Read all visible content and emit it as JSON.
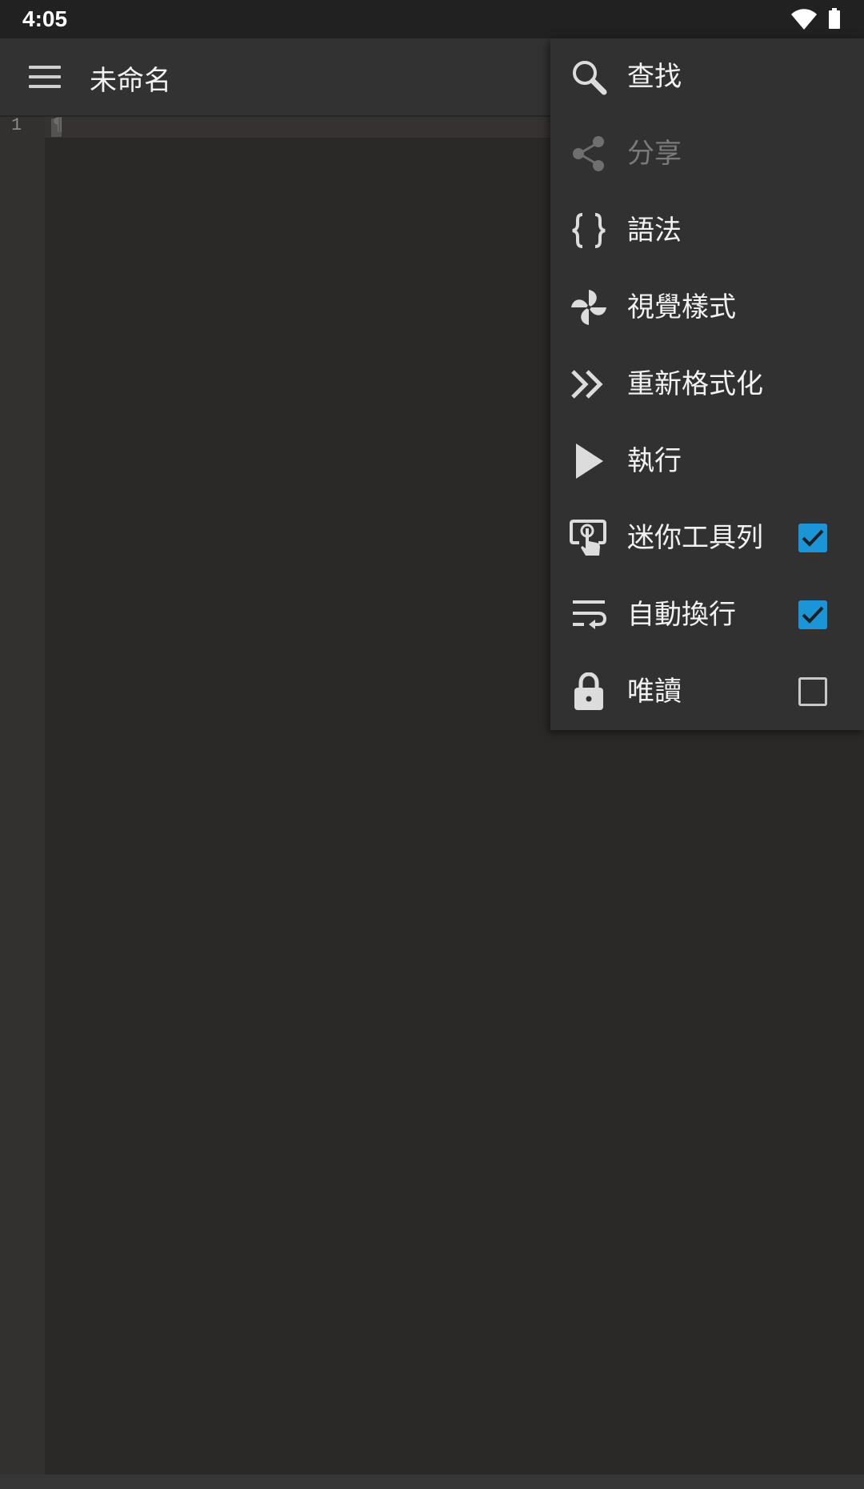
{
  "status_bar": {
    "time": "4:05",
    "icons": [
      "wifi-icon",
      "battery-icon"
    ]
  },
  "toolbar": {
    "menu_icon": "hamburger-menu-icon",
    "title": "未命名"
  },
  "editor": {
    "line_numbers": [
      "1"
    ],
    "current_line_text": "¶"
  },
  "overflow_menu": {
    "items": [
      {
        "label": "查找",
        "icon": "search-icon",
        "enabled": true
      },
      {
        "label": "分享",
        "icon": "share-icon",
        "enabled": false
      },
      {
        "label": "語法",
        "icon": "curly-braces-icon",
        "enabled": true
      },
      {
        "label": "視覺樣式",
        "icon": "pinwheel-icon",
        "enabled": true
      },
      {
        "label": "重新格式化",
        "icon": "double-chevron-right-icon",
        "enabled": true
      },
      {
        "label": "執行",
        "icon": "play-icon",
        "enabled": true
      },
      {
        "label": "迷你工具列",
        "icon": "touch-app-icon",
        "enabled": true,
        "checked": true
      },
      {
        "label": "自動換行",
        "icon": "wrap-text-icon",
        "enabled": true,
        "checked": true
      },
      {
        "label": "唯讀",
        "icon": "lock-icon",
        "enabled": true,
        "checked": false
      }
    ]
  },
  "colors": {
    "editor_background": "#2b2828",
    "toolbar_background": "#323232",
    "menu_background": "#313131",
    "checkbox_accent": "#1c95d8",
    "disabled_text": "#7a7a7a"
  }
}
